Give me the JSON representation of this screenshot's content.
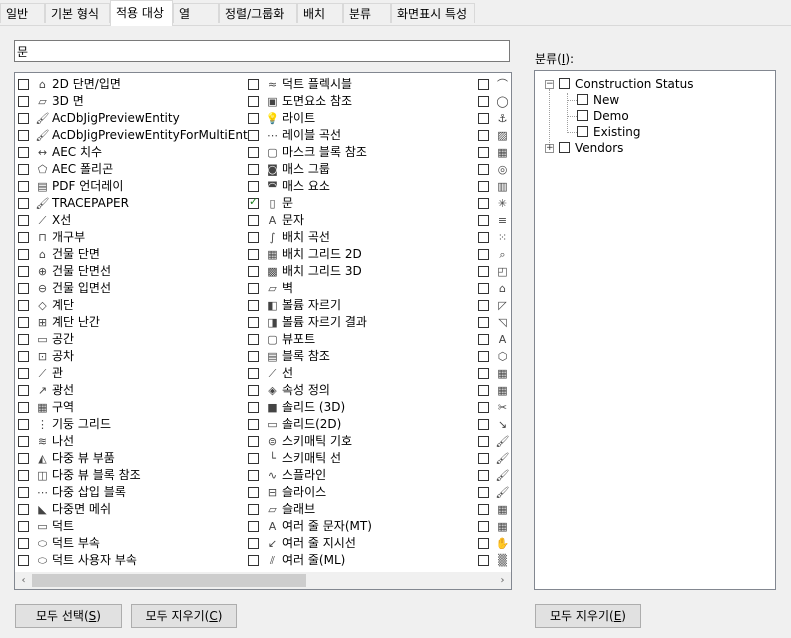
{
  "tabs": [
    "일반",
    "기본 형식",
    "적용 대상",
    "열",
    "정렬/그룹화",
    "배치",
    "분류",
    "화면표시 특성"
  ],
  "active_tab": "적용 대상",
  "search": {
    "value": "문"
  },
  "column1": [
    {
      "label": "2D 단면/입면",
      "icon": "house-icon",
      "checked": false
    },
    {
      "label": "3D 면",
      "icon": "face-icon",
      "checked": false
    },
    {
      "label": "AcDbJigPreviewEntity",
      "icon": "brush-icon",
      "checked": false
    },
    {
      "label": "AcDbJigPreviewEntityForMultiEnts",
      "icon": "brush-icon",
      "checked": false
    },
    {
      "label": "AEC 치수",
      "icon": "dimension-icon",
      "checked": false
    },
    {
      "label": "AEC 폴리곤",
      "icon": "polygon-icon",
      "checked": false
    },
    {
      "label": "PDF 언더레이",
      "icon": "pdf-icon",
      "checked": false
    },
    {
      "label": "TRACEPAPER",
      "icon": "brush-icon",
      "checked": false
    },
    {
      "label": "X선",
      "icon": "xline-icon",
      "checked": false
    },
    {
      "label": "개구부",
      "icon": "opening-icon",
      "checked": false
    },
    {
      "label": "건물 단면",
      "icon": "building-section-icon",
      "checked": false
    },
    {
      "label": "건물 단면선",
      "icon": "section-line-icon",
      "checked": false
    },
    {
      "label": "건물 입면선",
      "icon": "elevation-line-icon",
      "checked": false
    },
    {
      "label": "계단",
      "icon": "stair-icon",
      "checked": false
    },
    {
      "label": "계단 난간",
      "icon": "railing-icon",
      "checked": false
    },
    {
      "label": "공간",
      "icon": "space-icon",
      "checked": false
    },
    {
      "label": "공차",
      "icon": "tolerance-icon",
      "checked": false
    },
    {
      "label": "관",
      "icon": "pipe-icon",
      "checked": false
    },
    {
      "label": "광선",
      "icon": "ray-icon",
      "checked": false
    },
    {
      "label": "구역",
      "icon": "zone-icon",
      "checked": false
    },
    {
      "label": "기둥 그리드",
      "icon": "column-grid-icon",
      "checked": false
    },
    {
      "label": "나선",
      "icon": "helix-icon",
      "checked": false
    },
    {
      "label": "다중 뷰 부품",
      "icon": "mvpart-icon",
      "checked": false
    },
    {
      "label": "다중 뷰 블록 참조",
      "icon": "mvblock-icon",
      "checked": false
    },
    {
      "label": "다중 삽입 블록",
      "icon": "minsert-icon",
      "checked": false
    },
    {
      "label": "다중면 메쉬",
      "icon": "polyface-icon",
      "checked": false
    },
    {
      "label": "덕트",
      "icon": "duct-icon",
      "checked": false
    },
    {
      "label": "덕트 부속",
      "icon": "duct-fitting-icon",
      "checked": false
    },
    {
      "label": "덕트 사용자 부속",
      "icon": "duct-custom-icon",
      "checked": false
    }
  ],
  "column2": [
    {
      "label": "덕트 플렉시블",
      "icon": "flex-duct-icon",
      "checked": false
    },
    {
      "label": "도면요소 참조",
      "icon": "element-ref-icon",
      "checked": false
    },
    {
      "label": "라이트",
      "icon": "light-icon",
      "checked": false
    },
    {
      "label": "레이블 곡선",
      "icon": "label-curve-icon",
      "checked": false
    },
    {
      "label": "마스크 블록 참조",
      "icon": "mask-block-icon",
      "checked": false
    },
    {
      "label": "매스 그룹",
      "icon": "mass-group-icon",
      "checked": false
    },
    {
      "label": "매스 요소",
      "icon": "mass-element-icon",
      "checked": false
    },
    {
      "label": "문",
      "icon": "door-icon",
      "checked": true
    },
    {
      "label": "문자",
      "icon": "text-icon",
      "checked": false
    },
    {
      "label": "배치 곡선",
      "icon": "layout-curve-icon",
      "checked": false
    },
    {
      "label": "배치 그리드 2D",
      "icon": "grid2d-icon",
      "checked": false
    },
    {
      "label": "배치 그리드 3D",
      "icon": "grid3d-icon",
      "checked": false
    },
    {
      "label": "벽",
      "icon": "wall-icon",
      "checked": false
    },
    {
      "label": "볼륨 자르기",
      "icon": "volume-clip-icon",
      "checked": false
    },
    {
      "label": "볼륨 자르기 결과",
      "icon": "volume-clip-result-icon",
      "checked": false
    },
    {
      "label": "뷰포트",
      "icon": "viewport-icon",
      "checked": false
    },
    {
      "label": "블록 참조",
      "icon": "block-ref-icon",
      "checked": false
    },
    {
      "label": "선",
      "icon": "line-icon",
      "checked": false
    },
    {
      "label": "속성 정의",
      "icon": "attdef-icon",
      "checked": false
    },
    {
      "label": "솔리드 (3D)",
      "icon": "solid3d-icon",
      "checked": false
    },
    {
      "label": "솔리드(2D)",
      "icon": "solid2d-icon",
      "checked": false
    },
    {
      "label": "스키매틱 기호",
      "icon": "schematic-symbol-icon",
      "checked": false
    },
    {
      "label": "스키매틱 선",
      "icon": "schematic-line-icon",
      "checked": false
    },
    {
      "label": "스플라인",
      "icon": "spline-icon",
      "checked": false
    },
    {
      "label": "슬라이스",
      "icon": "slice-icon",
      "checked": false
    },
    {
      "label": "슬래브",
      "icon": "slab-icon",
      "checked": false
    },
    {
      "label": "여러 줄 문자(MT)",
      "icon": "mtext-icon",
      "checked": false
    },
    {
      "label": "여러 줄 지시선",
      "icon": "mleader-icon",
      "checked": false
    },
    {
      "label": "여러 줄(ML)",
      "icon": "mline-icon",
      "checked": false
    }
  ],
  "column3_icons": [
    "arc-icon",
    "circle-icon",
    "anchor-icon",
    "image-icon",
    "table-icon",
    "device-icon",
    "panel-icon",
    "light-point-icon",
    "pipe-run-icon",
    "points-icon",
    "search-icon",
    "window-icon",
    "roof-icon",
    "beam-icon",
    "member-icon",
    "text-a-icon",
    "shape-icon",
    "grid-icon",
    "grid-icon",
    "clip-icon",
    "leader-icon",
    "brush-icon",
    "brush-icon",
    "brush-icon",
    "brush-icon",
    "table-icon",
    "table-icon",
    "hand-icon",
    "hatch-icon"
  ],
  "hscroll": {
    "left": "‹",
    "right": "›"
  },
  "category": {
    "label": "분류(",
    "accel": "I",
    "label_end": "):",
    "tree": [
      {
        "label": "Construction Status",
        "expander": "−",
        "children": [
          "New",
          "Demo",
          "Existing"
        ]
      },
      {
        "label": "Vendors",
        "expander": "+"
      }
    ]
  },
  "buttons": {
    "select_all": "모두 선택(",
    "select_all_key": "S",
    "clear_all": "모두 지우기(",
    "clear_all_key": "C",
    "clear_all_cat": "모두 지우기(",
    "clear_all_cat_key": "E",
    "close": ")"
  }
}
